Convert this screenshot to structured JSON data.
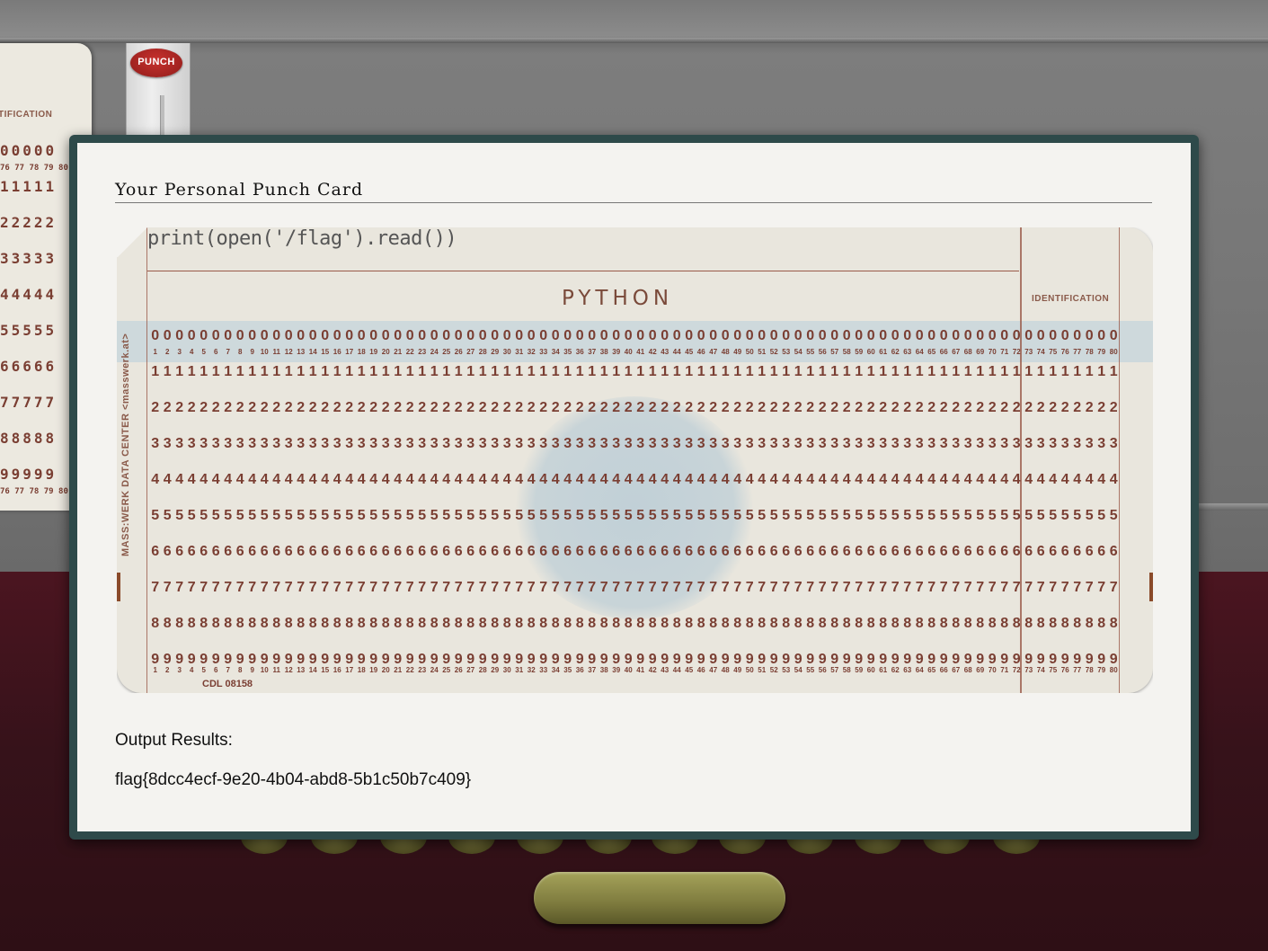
{
  "machine": {
    "punch_label": "PUNCH",
    "left_card": {
      "ident_label": "TIFICATION",
      "rows": [
        "00000",
        "76 77 78 79 80",
        "11111",
        "22222",
        "33333",
        "44444",
        "55555",
        "66666",
        "77777",
        "88888",
        "99999",
        "76 77 78 79 80"
      ]
    }
  },
  "modal": {
    "title": "Your Personal Punch Card",
    "card": {
      "printed_code": "print(open('/flag').read())",
      "language": "PYTHON",
      "ident_label": "IDENTIFICATION",
      "side_label": "MASS:WERK DATA CENTER <masswerk.at>",
      "card_code": "CDL   08158",
      "rows": [
        "0",
        "1",
        "2",
        "3",
        "4",
        "5",
        "6",
        "7",
        "8",
        "9"
      ],
      "columns": 80
    },
    "output_label": "Output Results:",
    "output_value": "flag{8dcc4ecf-9e20-4b04-abd8-5b1c50b7c409}"
  }
}
